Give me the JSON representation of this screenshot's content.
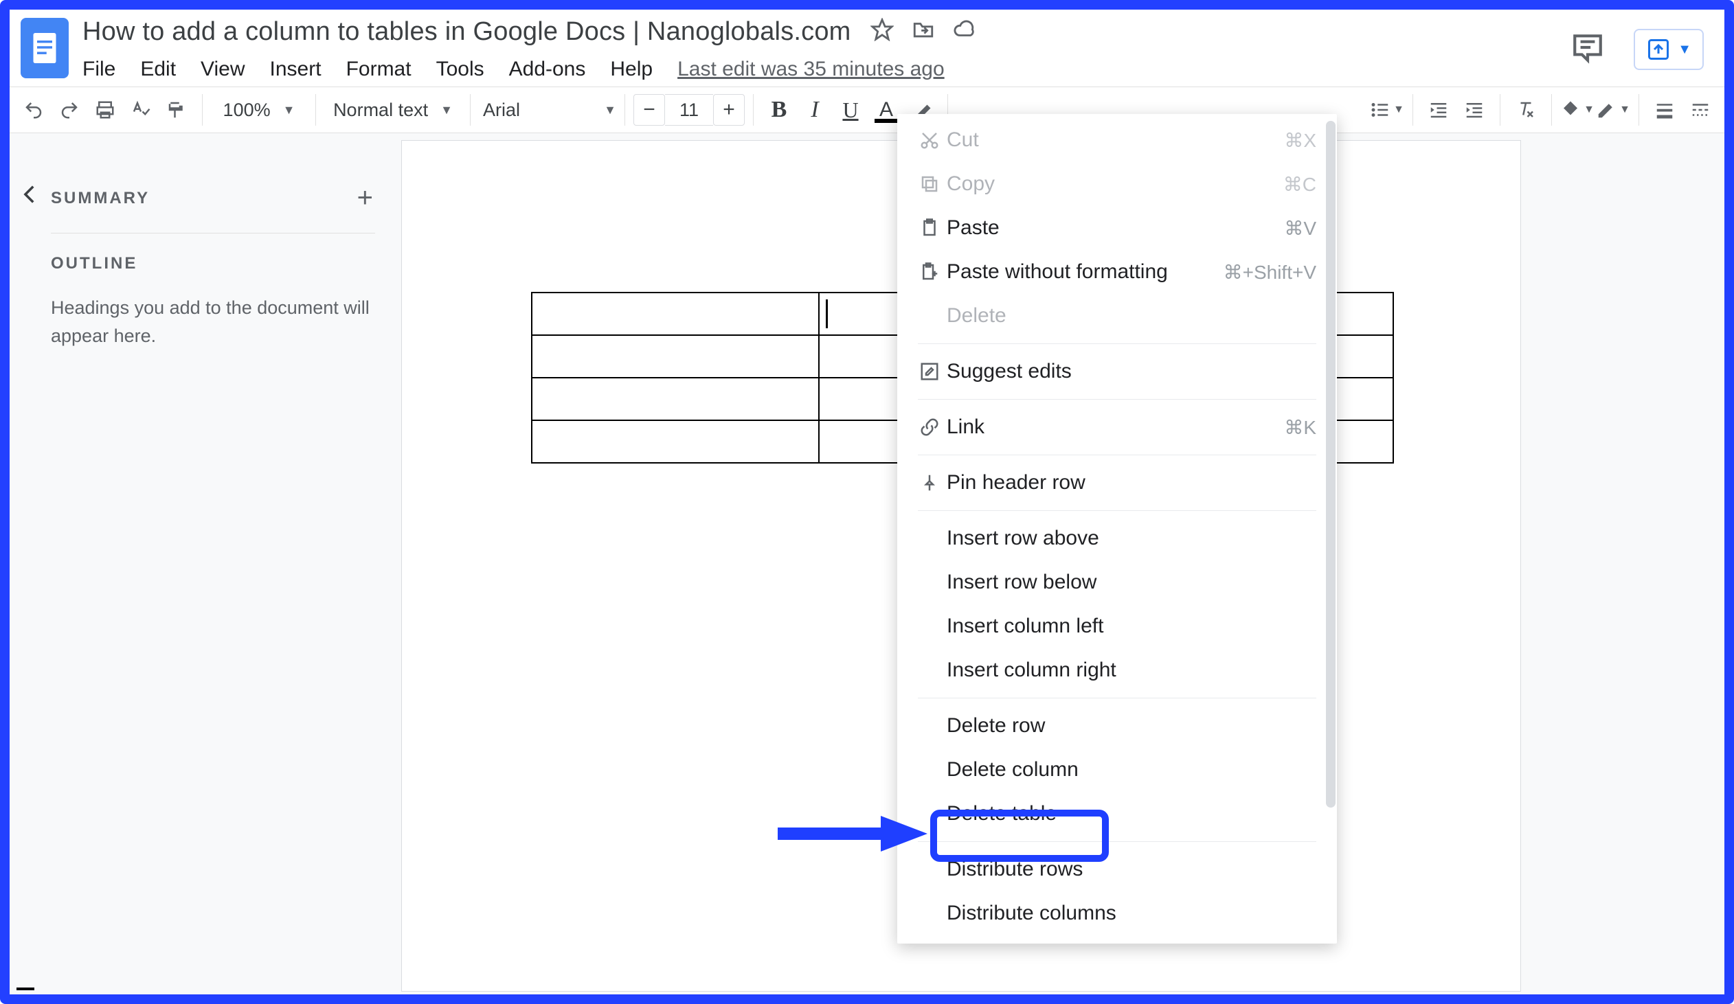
{
  "doc": {
    "title": "How to add a column to tables in Google Docs | Nanoglobals.com",
    "last_edit": "Last edit was 35 minutes ago"
  },
  "menu": {
    "file": "File",
    "edit": "Edit",
    "view": "View",
    "insert": "Insert",
    "format": "Format",
    "tools": "Tools",
    "addons": "Add-ons",
    "help": "Help"
  },
  "toolbar": {
    "zoom": "100%",
    "style": "Normal text",
    "font": "Arial",
    "font_size": "11"
  },
  "outline": {
    "summary_label": "SUMMARY",
    "outline_label": "OUTLINE",
    "empty_text": "Headings you add to the document will appear here."
  },
  "context_menu": {
    "cut": "Cut",
    "cut_sc": "⌘X",
    "copy": "Copy",
    "copy_sc": "⌘C",
    "paste": "Paste",
    "paste_sc": "⌘V",
    "paste_wo": "Paste without formatting",
    "paste_wo_sc": "⌘+Shift+V",
    "delete": "Delete",
    "suggest": "Suggest edits",
    "link": "Link",
    "link_sc": "⌘K",
    "pin": "Pin header row",
    "row_above": "Insert row above",
    "row_below": "Insert row below",
    "col_left": "Insert column left",
    "col_right": "Insert column right",
    "del_row": "Delete row",
    "del_col": "Delete column",
    "del_table": "Delete table",
    "dist_rows": "Distribute rows",
    "dist_cols": "Distribute columns"
  }
}
